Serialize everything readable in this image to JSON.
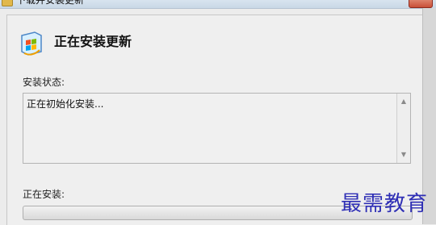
{
  "window": {
    "title": "下载并安装更新"
  },
  "header": {
    "title": "正在安装更新"
  },
  "status": {
    "label": "安装状态:",
    "text": "正在初始化安装..."
  },
  "progress": {
    "label": "正在安装:",
    "value": 0
  },
  "watermark": {
    "text": "最需教育"
  },
  "icons": {
    "window": "windows-update-icon",
    "header": "windows-update-icon",
    "scroll_up": "triangle-up-icon",
    "scroll_down": "triangle-down-icon"
  }
}
